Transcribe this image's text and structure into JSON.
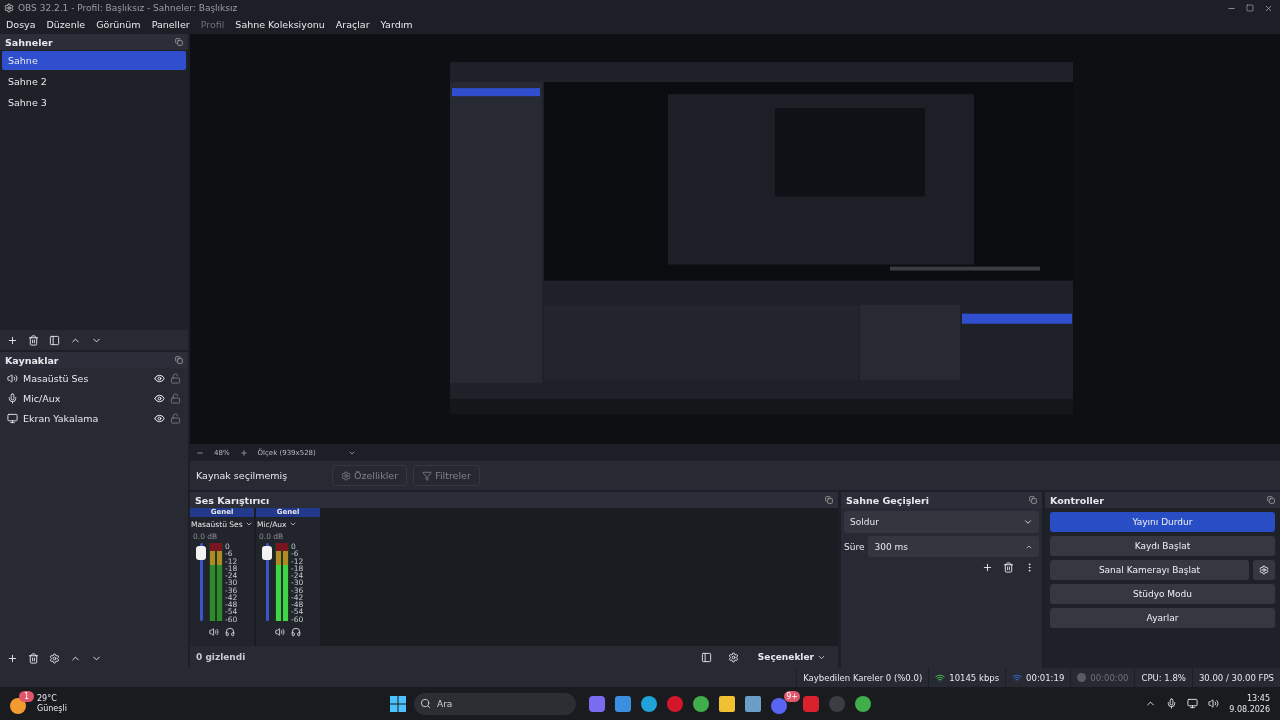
{
  "window": {
    "title": "OBS 32.2.1 - Profil: Başlıksız - Sahneler: Başlıksız"
  },
  "menu": [
    {
      "label": "Dosya",
      "disabled": false
    },
    {
      "label": "Düzenle",
      "disabled": false
    },
    {
      "label": "Görünüm",
      "disabled": false
    },
    {
      "label": "Paneller",
      "disabled": false
    },
    {
      "label": "Profil",
      "disabled": true
    },
    {
      "label": "Sahne Koleksiyonu",
      "disabled": false
    },
    {
      "label": "Araçlar",
      "disabled": false
    },
    {
      "label": "Yardım",
      "disabled": false
    }
  ],
  "scenes": {
    "title": "Sahneler",
    "items": [
      {
        "label": "Sahne",
        "selected": true
      },
      {
        "label": "Sahne 2",
        "selected": false
      },
      {
        "label": "Sahne 3",
        "selected": false
      }
    ]
  },
  "sources": {
    "title": "Kaynaklar",
    "items": [
      {
        "kind": "audio",
        "label": "Masaüstü Ses",
        "visible": true,
        "locked": false
      },
      {
        "kind": "mic",
        "label": "Mic/Aux",
        "visible": true,
        "locked": false
      },
      {
        "kind": "display",
        "label": "Ekran Yakalama",
        "visible": true,
        "locked": false
      }
    ]
  },
  "zoom_bar": {
    "zoom": "48%",
    "scale": "Ölçek (939x528)"
  },
  "source_toolbar": {
    "label": "Kaynak seçilmemiş",
    "buttons": [
      {
        "kind": "gear",
        "label": "Özellikler",
        "disabled": true
      },
      {
        "kind": "filter",
        "label": "Filtreler",
        "disabled": true
      }
    ]
  },
  "mixer": {
    "title": "Ses Karıştırıcı",
    "channels": [
      {
        "group": "Genel",
        "name": "Masaüstü Ses",
        "reading": "0.0 dB",
        "level": 0.95,
        "scale": [
          "0",
          "-6",
          "-12",
          "-18",
          "-24",
          "-30",
          "-36",
          "-42",
          "-48",
          "-54",
          "-60"
        ]
      },
      {
        "group": "Genel",
        "name": "Mic/Aux",
        "reading": "0.0 dB",
        "level": 0.95,
        "scale": [
          "0",
          "-6",
          "-12",
          "-18",
          "-24",
          "-30",
          "-36",
          "-42",
          "-48",
          "-54",
          "-60"
        ]
      }
    ],
    "hidden": "0 gizlendi",
    "options": "Seçenekler"
  },
  "transitions": {
    "title": "Sahne Geçişleri",
    "transition": "Soldur",
    "duration_label": "Süre",
    "duration": "300 ms"
  },
  "controls": {
    "title": "Kontroller",
    "buttons": [
      {
        "kind": "plain",
        "label": "Yayını Durdur",
        "active": true
      },
      {
        "kind": "plain",
        "label": "Kaydı Başlat",
        "active": false
      },
      {
        "kind": "with-settings",
        "label": "Sanal Kamerayı Başlat",
        "active": false
      },
      {
        "kind": "plain",
        "label": "Stüdyo Modu",
        "active": false
      },
      {
        "kind": "plain",
        "label": "Ayarlar",
        "active": false
      }
    ]
  },
  "status_bar": {
    "dropped": "Kaybedilen Kareler 0 (%0.0)",
    "bitrate": "10145 kbps",
    "stream_time": "00:01:19",
    "record_time": "00:00:00",
    "cpu": "CPU: 1.8%",
    "fps": "30.00 / 30.00 FPS"
  },
  "taskbar": {
    "weather": {
      "badge": "1",
      "temperature": "29°C",
      "condition": "Güneşli"
    },
    "search": {
      "placeholder": "Ara"
    },
    "apps": [
      {
        "kind": "copilot"
      },
      {
        "kind": "store"
      },
      {
        "kind": "edge"
      },
      {
        "kind": "opera"
      },
      {
        "kind": "chrome"
      },
      {
        "kind": "folder"
      },
      {
        "kind": "diamond"
      },
      {
        "kind": "discord",
        "badge": "9+"
      },
      {
        "kind": "red"
      },
      {
        "kind": "obs"
      },
      {
        "kind": "chrome"
      }
    ],
    "time": "13:45",
    "date": "9.08.2026"
  }
}
